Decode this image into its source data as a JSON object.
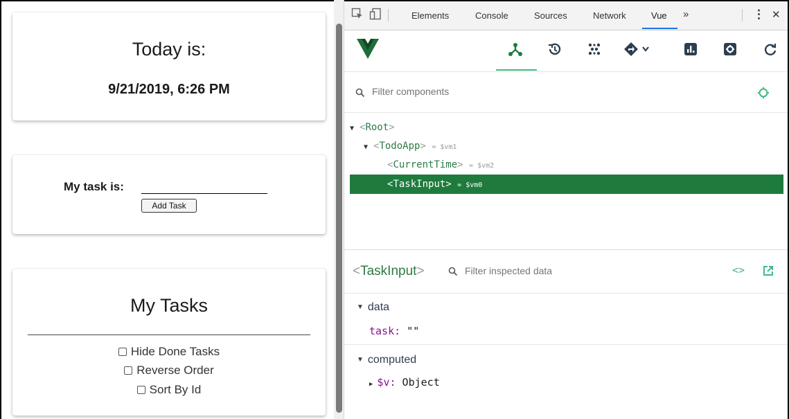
{
  "app": {
    "time_card": {
      "title": "Today is:",
      "datetime": "9/21/2019, 6:26 PM"
    },
    "task_card": {
      "label": "My task is:",
      "input_value": "",
      "button": "Add Task"
    },
    "tasks_card": {
      "title": "My Tasks",
      "options": [
        {
          "label": "Hide Done Tasks",
          "checked": false
        },
        {
          "label": "Reverse Order",
          "checked": false
        },
        {
          "label": "Sort By Id",
          "checked": false
        }
      ]
    }
  },
  "devtools": {
    "tabs": [
      "Elements",
      "Console",
      "Sources",
      "Network",
      "Vue"
    ],
    "active_tab": "Vue",
    "more_glyph": "»",
    "menu_glyph": "⋮",
    "close_glyph": "✕",
    "vue_toolbar_icons": [
      "components-icon",
      "history-icon",
      "vuex-icon",
      "routing-icon",
      "performance-icon",
      "settings-icon",
      "refresh-icon"
    ],
    "filter_components_placeholder": "Filter components",
    "tree": [
      {
        "arrow": "▼",
        "name": "Root",
        "vm": "",
        "depth": 0
      },
      {
        "arrow": "▼",
        "name": "TodoApp",
        "vm": "= $vm1",
        "depth": 1
      },
      {
        "arrow": "",
        "name": "CurrentTime",
        "vm": "= $vm2",
        "depth": 2
      },
      {
        "arrow": "",
        "name": "TaskInput",
        "vm": "= $vm0",
        "depth": 2,
        "selected": true
      }
    ],
    "inspector": {
      "component": "TaskInput",
      "filter_placeholder": "Filter inspected data",
      "sections": [
        {
          "label": "data",
          "props": [
            {
              "key": "task",
              "value": "\"\""
            }
          ]
        },
        {
          "label": "computed",
          "props": [
            {
              "key": "$v",
              "value": "Object"
            }
          ]
        }
      ]
    }
  },
  "colors": {
    "vue_green": "#42b983",
    "selected_row": "#1e7b3d",
    "tab_underline": "#1a73e8"
  }
}
